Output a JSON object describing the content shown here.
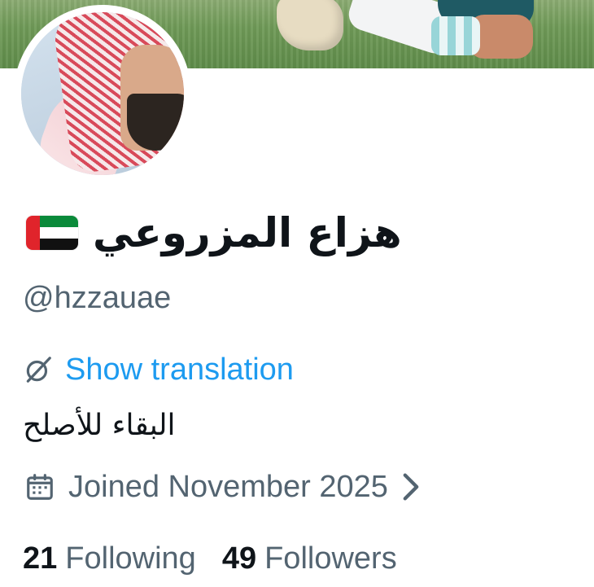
{
  "profile": {
    "display_name": "هزاع المزروعي",
    "flag_icon": "uae-flag-icon",
    "handle": "@hzzauae",
    "translation_icon": "translate-icon",
    "translation_label": "Show translation",
    "bio": "البقاء للأصلح",
    "joined_icon": "calendar-icon",
    "joined_label": "Joined November 2025",
    "following_count": "21",
    "following_label": "Following",
    "followers_count": "49",
    "followers_label": "Followers"
  },
  "colors": {
    "text_primary": "#0f1419",
    "text_secondary": "#536471",
    "link": "#1d9bf0"
  }
}
